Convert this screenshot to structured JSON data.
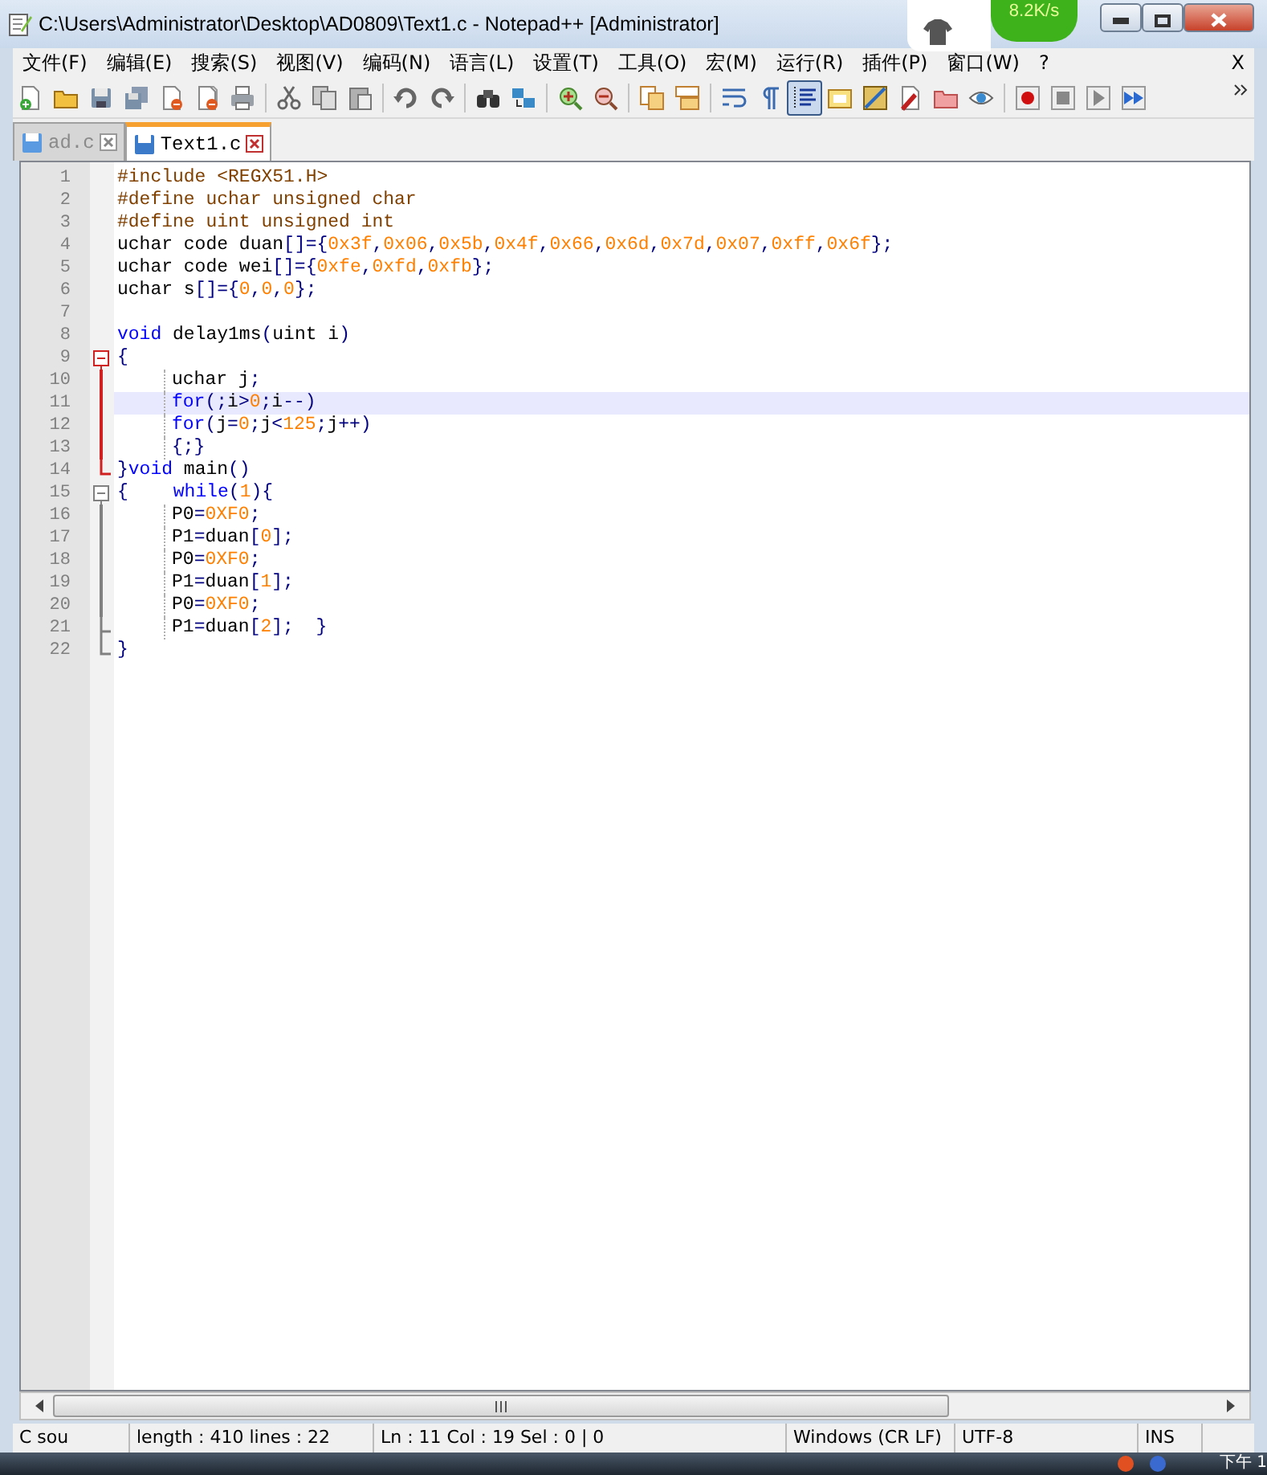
{
  "window": {
    "title": "C:\\Users\\Administrator\\Desktop\\AD0809\\Text1.c - Notepad++ [Administrator]"
  },
  "speed_widget": {
    "text": "8.2K/s"
  },
  "menu": {
    "items": [
      "文件(F)",
      "编辑(E)",
      "搜索(S)",
      "视图(V)",
      "编码(N)",
      "语言(L)",
      "设置(T)",
      "工具(O)",
      "宏(M)",
      "运行(R)",
      "插件(P)",
      "窗口(W)",
      "?"
    ],
    "close_label": "X"
  },
  "toolbar": {
    "buttons": [
      {
        "selected": false
      },
      {
        "selected": false
      },
      {
        "selected": false
      },
      {
        "selected": false
      },
      {
        "selected": false
      },
      {
        "selected": false
      },
      {
        "selected": false
      },
      {
        "selected": false
      },
      {
        "selected": false
      },
      {
        "selected": false
      },
      {
        "selected": false
      },
      {
        "selected": false
      },
      {
        "selected": false
      },
      {
        "selected": false
      },
      {
        "selected": false
      },
      {
        "selected": false
      },
      {
        "selected": false
      },
      {
        "selected": false
      },
      {
        "selected": false
      },
      {
        "selected": false
      },
      {
        "selected": true
      },
      {
        "selected": false
      },
      {
        "selected": false
      },
      {
        "selected": false
      },
      {
        "selected": false
      },
      {
        "selected": false
      },
      {
        "selected": false
      },
      {
        "selected": false
      },
      {
        "selected": false
      },
      {
        "selected": false
      }
    ]
  },
  "tabs": [
    {
      "label": "ad.c",
      "selected": false
    },
    {
      "label": "Text1.c",
      "selected": true
    }
  ],
  "lines": [
    {
      "number": "1",
      "kind": "plain",
      "current": false,
      "indent": false,
      "tokens": [
        {
          "kind": "pp",
          "text": "#include <REGX51.H>"
        }
      ]
    },
    {
      "number": "2",
      "kind": "plain",
      "current": false,
      "indent": false,
      "tokens": [
        {
          "kind": "pp",
          "text": "#define uchar unsigned char"
        }
      ]
    },
    {
      "number": "3",
      "kind": "plain",
      "current": false,
      "indent": false,
      "tokens": [
        {
          "kind": "pp",
          "text": "#define uint unsigned int"
        }
      ]
    },
    {
      "number": "4",
      "kind": "plain",
      "current": false,
      "indent": false,
      "tokens": [
        {
          "kind": "text",
          "text": "uchar code duan"
        },
        {
          "kind": "op",
          "text": "[]={"
        },
        {
          "kind": "num",
          "text": "0x3f"
        },
        {
          "kind": "op",
          "text": ","
        },
        {
          "kind": "num",
          "text": "0x06"
        },
        {
          "kind": "op",
          "text": ","
        },
        {
          "kind": "num",
          "text": "0x5b"
        },
        {
          "kind": "op",
          "text": ","
        },
        {
          "kind": "num",
          "text": "0x4f"
        },
        {
          "kind": "op",
          "text": ","
        },
        {
          "kind": "num",
          "text": "0x66"
        },
        {
          "kind": "op",
          "text": ","
        },
        {
          "kind": "num",
          "text": "0x6d"
        },
        {
          "kind": "op",
          "text": ","
        },
        {
          "kind": "num",
          "text": "0x7d"
        },
        {
          "kind": "op",
          "text": ","
        },
        {
          "kind": "num",
          "text": "0x07"
        },
        {
          "kind": "op",
          "text": ","
        },
        {
          "kind": "num",
          "text": "0xff"
        },
        {
          "kind": "op",
          "text": ","
        },
        {
          "kind": "num",
          "text": "0x6f"
        },
        {
          "kind": "op",
          "text": "};"
        }
      ]
    },
    {
      "number": "5",
      "kind": "plain",
      "current": false,
      "indent": false,
      "tokens": [
        {
          "kind": "text",
          "text": "uchar code wei"
        },
        {
          "kind": "op",
          "text": "[]={"
        },
        {
          "kind": "num",
          "text": "0xfe"
        },
        {
          "kind": "op",
          "text": ","
        },
        {
          "kind": "num",
          "text": "0xfd"
        },
        {
          "kind": "op",
          "text": ","
        },
        {
          "kind": "num",
          "text": "0xfb"
        },
        {
          "kind": "op",
          "text": "};"
        }
      ]
    },
    {
      "number": "6",
      "kind": "plain",
      "current": false,
      "indent": false,
      "tokens": [
        {
          "kind": "text",
          "text": "uchar s"
        },
        {
          "kind": "op",
          "text": "[]={"
        },
        {
          "kind": "num",
          "text": "0"
        },
        {
          "kind": "op",
          "text": ","
        },
        {
          "kind": "num",
          "text": "0"
        },
        {
          "kind": "op",
          "text": ","
        },
        {
          "kind": "num",
          "text": "0"
        },
        {
          "kind": "op",
          "text": "};"
        }
      ]
    },
    {
      "number": "7",
      "kind": "plain"
    },
    {
      "number": "8",
      "kind": "plain",
      "current": false,
      "indent": false,
      "tokens": [
        {
          "kind": "kw",
          "text": "void"
        },
        {
          "kind": "text",
          "text": " delay1ms"
        },
        {
          "kind": "op",
          "text": "("
        },
        {
          "kind": "text",
          "text": "uint i"
        },
        {
          "kind": "op",
          "text": ")"
        }
      ]
    },
    {
      "number": "9",
      "kind": "fold-start",
      "fold_active": true,
      "current": false,
      "indent": false,
      "tokens": [
        {
          "kind": "op",
          "text": "{"
        }
      ]
    },
    {
      "number": "10",
      "kind": "fold-body",
      "fold_active": true,
      "current": false,
      "indent": true,
      "tokens": [
        {
          "kind": "text",
          "text": "uchar j"
        },
        {
          "kind": "op",
          "text": ";"
        }
      ]
    },
    {
      "number": "11",
      "kind": "fold-body",
      "fold_active": true,
      "current": true,
      "indent": true,
      "tokens": [
        {
          "kind": "kw",
          "text": "for"
        },
        {
          "kind": "op",
          "text": "(;"
        },
        {
          "kind": "text",
          "text": "i"
        },
        {
          "kind": "op",
          "text": ">"
        },
        {
          "kind": "num",
          "text": "0"
        },
        {
          "kind": "op",
          "text": ";"
        },
        {
          "kind": "text",
          "text": "i"
        },
        {
          "kind": "op",
          "text": "--)"
        }
      ]
    },
    {
      "number": "12",
      "kind": "fold-body",
      "fold_active": true,
      "current": false,
      "indent": true,
      "tokens": [
        {
          "kind": "kw",
          "text": "for"
        },
        {
          "kind": "op",
          "text": "("
        },
        {
          "kind": "text",
          "text": "j"
        },
        {
          "kind": "op",
          "text": "="
        },
        {
          "kind": "num",
          "text": "0"
        },
        {
          "kind": "op",
          "text": ";"
        },
        {
          "kind": "text",
          "text": "j"
        },
        {
          "kind": "op",
          "text": "<"
        },
        {
          "kind": "num",
          "text": "125"
        },
        {
          "kind": "op",
          "text": ";"
        },
        {
          "kind": "text",
          "text": "j"
        },
        {
          "kind": "op",
          "text": "++)"
        }
      ]
    },
    {
      "number": "13",
      "kind": "fold-body",
      "fold_active": true,
      "current": false,
      "indent": true,
      "tokens": [
        {
          "kind": "op",
          "text": "{;}"
        }
      ]
    },
    {
      "number": "14",
      "kind": "fold-end",
      "fold_active": true,
      "current": false,
      "indent": false,
      "tokens": [
        {
          "kind": "op",
          "text": "}"
        },
        {
          "kind": "kw",
          "text": "void"
        },
        {
          "kind": "text",
          "text": " main"
        },
        {
          "kind": "op",
          "text": "()"
        }
      ]
    },
    {
      "number": "15",
      "kind": "fold-start",
      "fold_active": false,
      "current": false,
      "indent": false,
      "tokens": [
        {
          "kind": "op",
          "text": "{"
        },
        {
          "kind": "tab"
        },
        {
          "kind": "kw",
          "text": "while"
        },
        {
          "kind": "op",
          "text": "("
        },
        {
          "kind": "num",
          "text": "1"
        },
        {
          "kind": "op",
          "text": "){"
        }
      ]
    },
    {
      "number": "16",
      "kind": "fold-body",
      "fold_active": false,
      "current": false,
      "indent": true,
      "tokens": [
        {
          "kind": "text",
          "text": "P0"
        },
        {
          "kind": "op",
          "text": "="
        },
        {
          "kind": "num",
          "text": "0XF0"
        },
        {
          "kind": "op",
          "text": ";"
        }
      ]
    },
    {
      "number": "17",
      "kind": "fold-body",
      "fold_active": false,
      "current": false,
      "indent": true,
      "tokens": [
        {
          "kind": "text",
          "text": "P1"
        },
        {
          "kind": "op",
          "text": "="
        },
        {
          "kind": "text",
          "text": "duan"
        },
        {
          "kind": "op",
          "text": "["
        },
        {
          "kind": "num",
          "text": "0"
        },
        {
          "kind": "op",
          "text": "];"
        }
      ]
    },
    {
      "number": "18",
      "kind": "fold-body",
      "fold_active": false,
      "current": false,
      "indent": true,
      "tokens": [
        {
          "kind": "text",
          "text": "P0"
        },
        {
          "kind": "op",
          "text": "="
        },
        {
          "kind": "num",
          "text": "0XF0"
        },
        {
          "kind": "op",
          "text": ";"
        }
      ]
    },
    {
      "number": "19",
      "kind": "fold-body",
      "fold_active": false,
      "current": false,
      "indent": true,
      "tokens": [
        {
          "kind": "text",
          "text": "P1"
        },
        {
          "kind": "op",
          "text": "="
        },
        {
          "kind": "text",
          "text": "duan"
        },
        {
          "kind": "op",
          "text": "["
        },
        {
          "kind": "num",
          "text": "1"
        },
        {
          "kind": "op",
          "text": "];"
        }
      ]
    },
    {
      "number": "20",
      "kind": "fold-body",
      "fold_active": false,
      "current": false,
      "indent": true,
      "tokens": [
        {
          "kind": "text",
          "text": "P0"
        },
        {
          "kind": "op",
          "text": "="
        },
        {
          "kind": "num",
          "text": "0XF0"
        },
        {
          "kind": "op",
          "text": ";"
        }
      ]
    },
    {
      "number": "21",
      "kind": "fold-mid",
      "fold_active": false,
      "current": false,
      "indent": true,
      "tokens": [
        {
          "kind": "text",
          "text": "P1"
        },
        {
          "kind": "op",
          "text": "="
        },
        {
          "kind": "text",
          "text": "duan"
        },
        {
          "kind": "op",
          "text": "["
        },
        {
          "kind": "num",
          "text": "2"
        },
        {
          "kind": "op",
          "text": "];  }"
        }
      ]
    },
    {
      "number": "22",
      "kind": "fold-end",
      "fold_active": false,
      "current": false,
      "indent": false,
      "tokens": [
        {
          "kind": "op",
          "text": "}"
        }
      ]
    }
  ],
  "status_bar": [
    "C sou",
    "length : 410    lines : 22",
    "Ln : 11    Col : 19    Sel : 0 | 0",
    "Windows (CR LF)",
    "UTF-8",
    "INS"
  ],
  "taskbar": {
    "clock": "下午 1"
  }
}
